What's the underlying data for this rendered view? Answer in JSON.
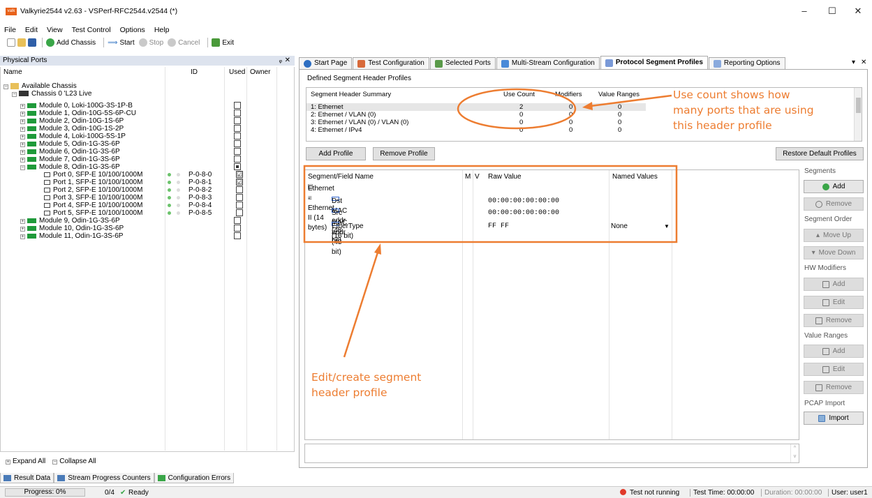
{
  "window": {
    "title": "Valkyrie2544 v2.63 - VSPerf-RFC2544.v2544 (*)",
    "app_icon_text": "valk",
    "minimize": "–",
    "maximize": "☐",
    "close": "✕"
  },
  "menu": [
    "File",
    "Edit",
    "View",
    "Test Control",
    "Options",
    "Help"
  ],
  "toolbar": {
    "add_chassis": "Add Chassis",
    "start": "Start",
    "stop": "Stop",
    "cancel": "Cancel",
    "exit": "Exit"
  },
  "physical_ports": {
    "title": "Physical Ports",
    "pin": "ᵩ",
    "close": "✕",
    "columns": {
      "name": "Name",
      "id": "ID",
      "used": "Used",
      "owner": "Owner"
    },
    "root": "Available Chassis",
    "chassis": "Chassis 0 'L23 Live",
    "modules_top": [
      "Module 0, Loki-100G-3S-1P-B",
      "Module 1, Odin-10G-5S-6P-CU",
      "Module 2, Odin-10G-1S-6P",
      "Module 3, Odin-10G-1S-2P",
      "Module 4, Loki-100G-5S-1P",
      "Module 5, Odin-1G-3S-6P",
      "Module 6, Odin-1G-3S-6P",
      "Module 7, Odin-1G-3S-6P",
      "Module 8, Odin-1G-3S-6P"
    ],
    "ports": [
      {
        "name": "Port 0, SFP-E 10/100/1000M",
        "id": "P-0-8-0",
        "used": "☑"
      },
      {
        "name": "Port 1, SFP-E 10/100/1000M",
        "id": "P-0-8-1",
        "used": "☑"
      },
      {
        "name": "Port 2, SFP-E 10/100/1000M",
        "id": "P-0-8-2",
        "used": ""
      },
      {
        "name": "Port 3, SFP-E 10/100/1000M",
        "id": "P-0-8-3",
        "used": ""
      },
      {
        "name": "Port 4, SFP-E 10/100/1000M",
        "id": "P-0-8-4",
        "used": ""
      },
      {
        "name": "Port 5, SFP-E 10/100/1000M",
        "id": "P-0-8-5",
        "used": ""
      }
    ],
    "modules_bottom": [
      "Module 9, Odin-1G-3S-6P",
      "Module 10, Odin-1G-3S-6P",
      "Module 11, Odin-1G-3S-6P"
    ],
    "expand_all": "Expand All",
    "collapse_all": "Collapse All"
  },
  "bottom_tabs": [
    "Result Data",
    "Stream Progress Counters",
    "Configuration Errors"
  ],
  "status": {
    "progress": "Progress: 0%",
    "count": "0/4",
    "ready": "Ready",
    "test_state": "Test not running",
    "test_time": "Test Time: 00:00:00",
    "duration": "Duration: 00:00:00",
    "user": "User: user1"
  },
  "tabs": [
    "Start Page",
    "Test Configuration",
    "Selected Ports",
    "Multi-Stream Configuration",
    "Protocol Segment Profiles",
    "Reporting Options"
  ],
  "tab_menu": "▾",
  "tab_close": "✕",
  "profiles": {
    "group_title": "Defined Segment Header Profiles",
    "columns": {
      "summary": "Segment Header Summary",
      "use_count": "Use Count",
      "modifiers": "Modifiers",
      "value_ranges": "Value Ranges"
    },
    "rows": [
      {
        "summary": "1: Ethernet",
        "use_count": "2",
        "modifiers": "0",
        "value_ranges": "0"
      },
      {
        "summary": "2: Ethernet / VLAN (0)",
        "use_count": "0",
        "modifiers": "0",
        "value_ranges": "0"
      },
      {
        "summary": "3: Ethernet / VLAN (0) / VLAN (0)",
        "use_count": "0",
        "modifiers": "0",
        "value_ranges": "0"
      },
      {
        "summary": "4: Ethernet / IPv4",
        "use_count": "0",
        "modifiers": "0",
        "value_ranges": "0"
      }
    ],
    "add_profile": "Add Profile",
    "remove_profile": "Remove Profile",
    "restore_defaults": "Restore Default Profiles"
  },
  "segment_editor": {
    "columns": {
      "name": "Segment/Field Name",
      "m": "M",
      "v": "V",
      "raw": "Raw Value",
      "named": "Named Values"
    },
    "segment": "Ethernet - Ethernet II (14 bytes)",
    "fields": [
      {
        "name": "Dst MAC addr (48 bit)",
        "raw": "00:00:00:00:00:00",
        "named": ""
      },
      {
        "name": "Src MAC addr (48 bit)",
        "raw": "00:00:00:00:00:00",
        "named": ""
      },
      {
        "name": "EtherType (16 bit)",
        "raw": "FF FF",
        "named": "None"
      }
    ]
  },
  "side_panel": {
    "segments": "Segments",
    "add": "Add",
    "remove": "Remove",
    "segment_order": "Segment Order",
    "move_up": "Move Up",
    "move_down": "Move Down",
    "hw_modifiers": "HW Modifiers",
    "hw_add": "Add",
    "hw_edit": "Edit",
    "hw_remove": "Remove",
    "value_ranges": "Value Ranges",
    "vr_add": "Add",
    "vr_edit": "Edit",
    "vr_remove": "Remove",
    "pcap_import": "PCAP Import",
    "import": "Import"
  },
  "annotations": {
    "use_count": [
      "Use count shows how",
      "many ports that are using",
      "this header profile"
    ],
    "edit": [
      "Edit/create segment",
      "header profile"
    ]
  },
  "colors": {
    "annotation": "#ed7d31",
    "module_icon": "#1f9a3a",
    "accent": "#dde3ee"
  }
}
